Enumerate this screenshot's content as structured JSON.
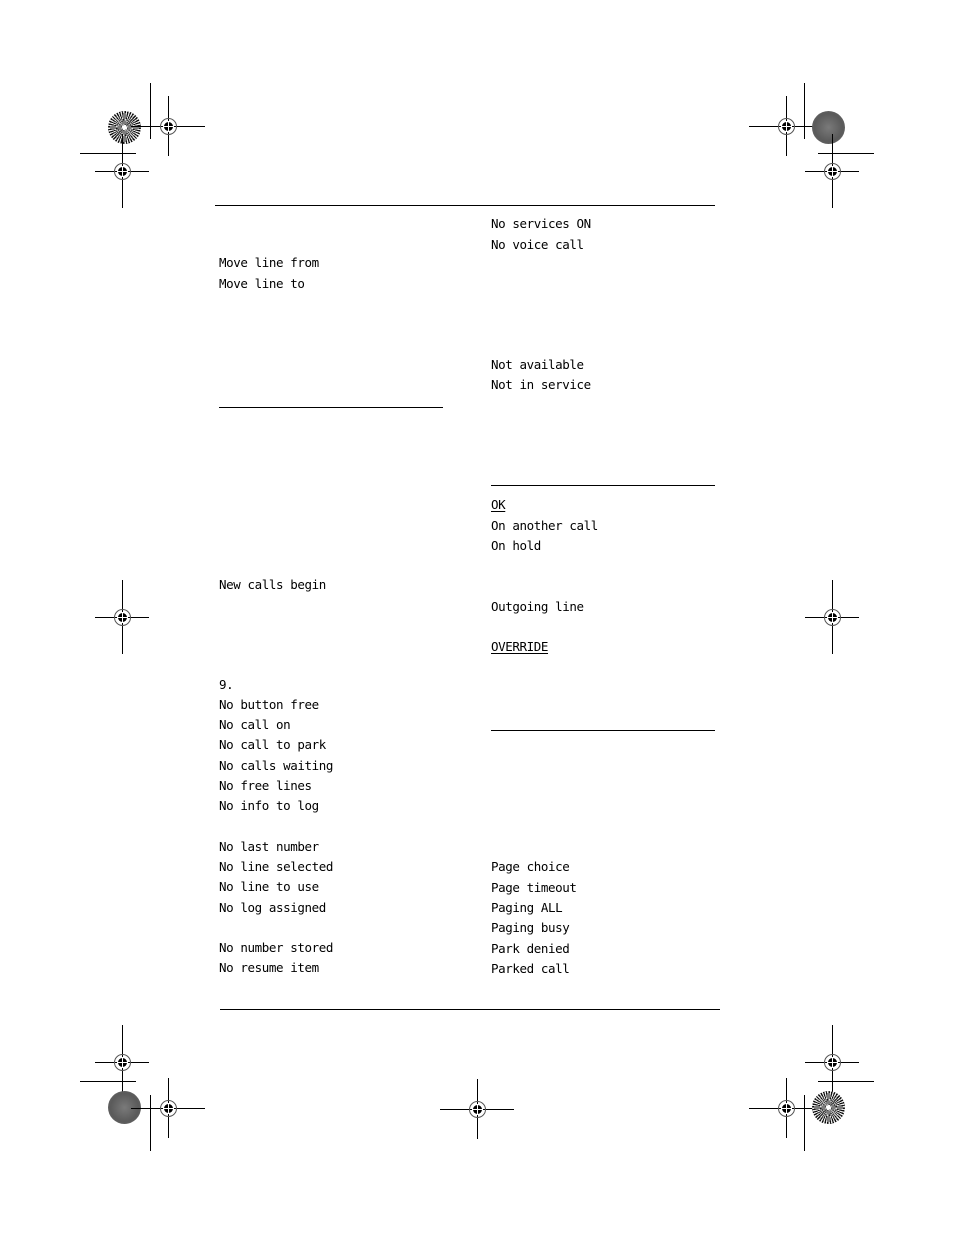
{
  "left_column": {
    "group1": [
      "Move line from",
      "Move line to"
    ],
    "group2": [
      "New calls begin"
    ],
    "group3": [
      "9.",
      "No button free",
      "No call on",
      "No call to park",
      "No calls waiting",
      "No free lines",
      "No info to log"
    ],
    "group4": [
      "No last number",
      "No line selected",
      "No line to use",
      "No log assigned"
    ],
    "group5": [
      "No number stored",
      "No resume item"
    ]
  },
  "right_column": {
    "group1": [
      "No services ON",
      "No voice call"
    ],
    "group2": [
      "Not available",
      "Not in service"
    ],
    "ok": "OK",
    "group3": [
      "On another call",
      "On hold"
    ],
    "outgoing": "Outgoing line",
    "override": "OVERRIDE",
    "group4": [
      "Page choice",
      "Page timeout",
      "Paging ALL",
      "Paging busy",
      "Park denied",
      "Parked call"
    ]
  },
  "print_marks": {
    "registration_mark_icon": "crosshair-circle",
    "color_target_icon": "starburst-target",
    "density_target_icon": "gray-density-target"
  }
}
